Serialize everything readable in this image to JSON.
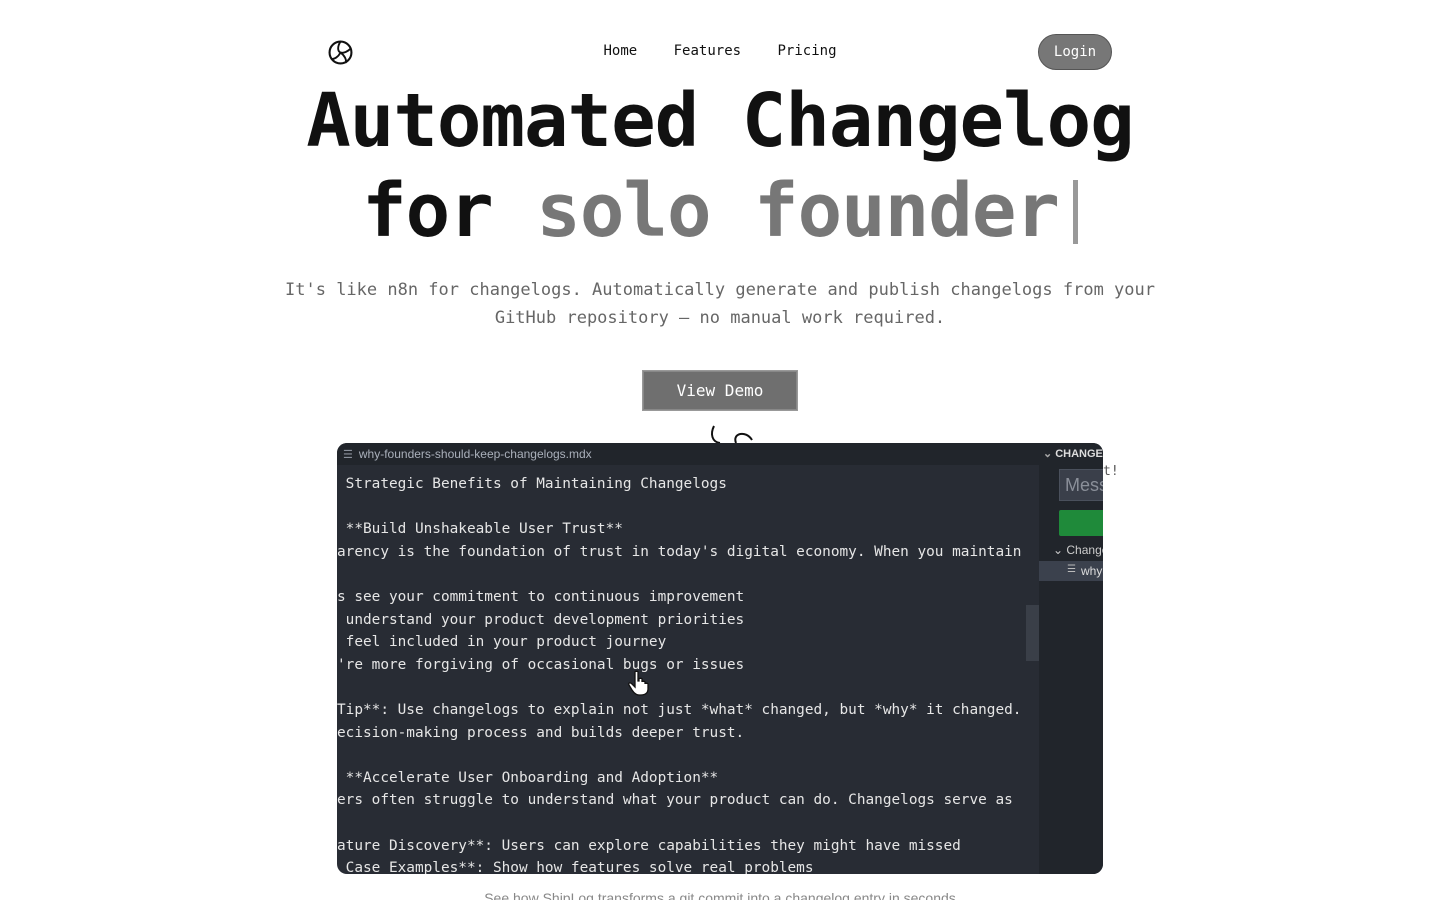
{
  "nav": {
    "logo_icon": "volleyball-logo-icon",
    "links": [
      "Home",
      "Features",
      "Pricing"
    ],
    "login_label": "Login"
  },
  "hero": {
    "line1": "Automated Changelog",
    "line2_prefix": "for ",
    "line2_accent": "solo founder"
  },
  "subtitle": {
    "line1": "It's like n8n for changelogs. Automatically generate and publish changelogs from your",
    "line2": "GitHub repository — no manual work required."
  },
  "demo_button_label": "View Demo",
  "editor": {
    "tab_filename": "why-founders-should-keep-changelogs.mdx",
    "code_lines": [
      " Strategic Benefits of Maintaining Changelogs",
      "",
      " **Build Unshakeable User Trust**",
      "arency is the foundation of trust in today's digital economy. When you maintain",
      "",
      "s see your commitment to continuous improvement",
      " understand your product development priorities",
      " feel included in your product journey",
      "'re more forgiving of occasional bugs or issues",
      "",
      "Tip**: Use changelogs to explain not just *what* changed, but *why* it changed.",
      "ecision-making process and builds deeper trust.",
      "",
      " **Accelerate User Onboarding and Adoption**",
      "ers often struggle to understand what your product can do. Changelogs serve as",
      "",
      "ature Discovery**: Users can explore capabilities they might have missed",
      " Case Examples**: Show how features solve real problems"
    ],
    "side_panel": {
      "header": "CHANGES",
      "message_placeholder": "Message",
      "tree_group": "Changes",
      "tree_file": "why-founders-should-keep-changelogs.mdx"
    }
  },
  "overflow_text": "t!",
  "caption": "See how ShipLog transforms a git commit into a changelog entry in seconds"
}
